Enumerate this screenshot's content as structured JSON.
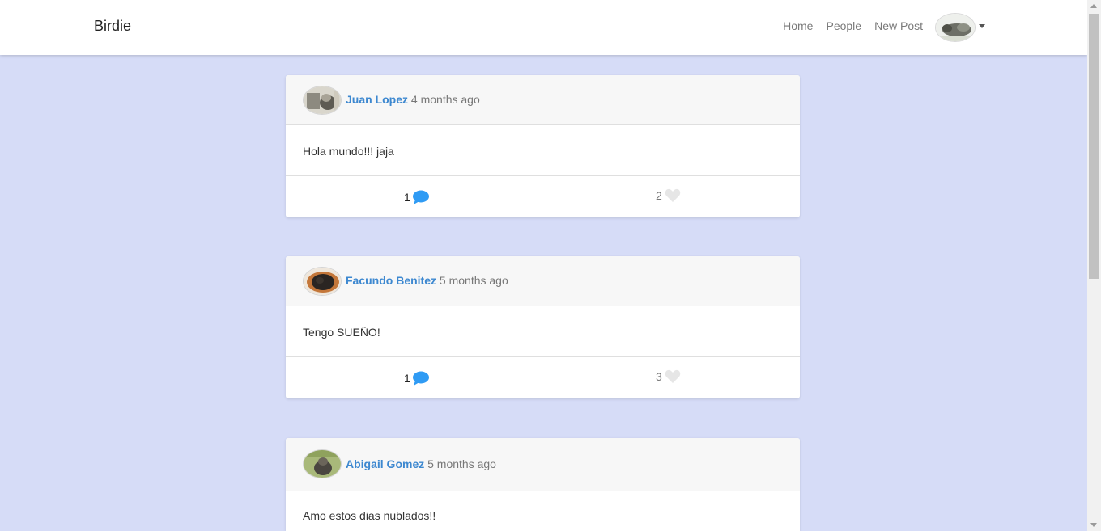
{
  "nav": {
    "brand": "Birdie",
    "links": [
      "Home",
      "People",
      "New Post"
    ]
  },
  "posts": [
    {
      "author": "Juan Lopez",
      "time": "4 months ago",
      "text": "Hola mundo!!! jaja",
      "comments": "1",
      "likes": "2"
    },
    {
      "author": "Facundo Benitez",
      "time": "5 months ago",
      "text": "Tengo SUEÑO!",
      "comments": "1",
      "likes": "3"
    },
    {
      "author": "Abigail Gomez",
      "time": "5 months ago",
      "text": "Amo estos dias nublados!!"
    }
  ],
  "colors": {
    "background": "#d6dcf7",
    "author_link": "#3d88d0",
    "comment_icon": "#2f9bf4",
    "heart_icon": "#e6e6e6"
  },
  "icons": [
    "comment-bubble-icon",
    "heart-icon",
    "dropdown-caret-icon"
  ]
}
